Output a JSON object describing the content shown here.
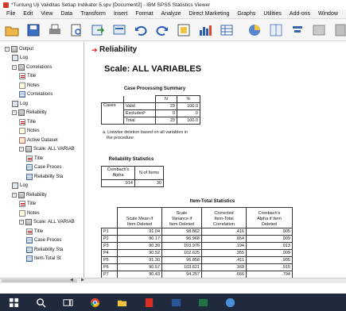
{
  "window": {
    "title": "*Tuntung Uji Validitas Setiap Indikator 5.spv [Document2] - IBM SPSS Statistics Viewer"
  },
  "menu": [
    {
      "label": "File"
    },
    {
      "label": "Edit"
    },
    {
      "label": "View"
    },
    {
      "label": "Data"
    },
    {
      "label": "Transform"
    },
    {
      "label": "Insert"
    },
    {
      "label": "Format"
    },
    {
      "label": "Analyze"
    },
    {
      "label": "Direct Marketing"
    },
    {
      "label": "Graphs"
    },
    {
      "label": "Utilities"
    },
    {
      "label": "Add-ons"
    },
    {
      "label": "Window"
    },
    {
      "label": "Help"
    }
  ],
  "toolbar_icons": [
    "open-icon",
    "save-icon",
    "print-icon",
    "print-preview-icon",
    "export-icon",
    "recall-dialog-icon",
    "undo-icon",
    "redo-icon",
    "goto-data-icon",
    "goto-case-icon",
    "variables-icon",
    "chart-icon",
    "pie-icon",
    "split-icon",
    "insert-output-icon",
    "designate-window-icon",
    "script-icon",
    "spss-icon"
  ],
  "nav": {
    "items": [
      {
        "label": "Output",
        "icon": "book-icon",
        "indent": 0,
        "box": "−"
      },
      {
        "label": "Log",
        "icon": "log-icon",
        "indent": 1,
        "box": ""
      },
      {
        "label": "Correlations",
        "icon": "book-icon",
        "indent": 1,
        "box": "−"
      },
      {
        "label": "Title",
        "icon": "title-icon",
        "indent": 2,
        "box": ""
      },
      {
        "label": "Notes",
        "icon": "notes-icon",
        "indent": 2,
        "box": ""
      },
      {
        "label": "Correlations",
        "icon": "table-icon",
        "indent": 2,
        "box": ""
      },
      {
        "label": "Log",
        "icon": "log-icon",
        "indent": 1,
        "box": ""
      },
      {
        "label": "Reliability",
        "icon": "book-icon",
        "indent": 1,
        "box": "−"
      },
      {
        "label": "Title",
        "icon": "title-icon",
        "indent": 2,
        "box": ""
      },
      {
        "label": "Notes",
        "icon": "notes-icon",
        "indent": 2,
        "box": ""
      },
      {
        "label": "Active Dataset",
        "icon": "data-icon",
        "indent": 2,
        "box": ""
      },
      {
        "label": "Scale: ALL VARIAB",
        "icon": "book-icon",
        "indent": 2,
        "box": "−"
      },
      {
        "label": "Title",
        "icon": "title-icon",
        "indent": 3,
        "box": ""
      },
      {
        "label": "Case Proces",
        "icon": "table-icon",
        "indent": 3,
        "box": ""
      },
      {
        "label": "Reliability Sta",
        "icon": "table-icon",
        "indent": 3,
        "box": ""
      },
      {
        "label": "Log",
        "icon": "log-icon",
        "indent": 1,
        "box": ""
      },
      {
        "label": "Reliability",
        "icon": "book-icon",
        "indent": 1,
        "box": "−"
      },
      {
        "label": "Title",
        "icon": "title-icon",
        "indent": 2,
        "box": ""
      },
      {
        "label": "Notes",
        "icon": "notes-icon",
        "indent": 2,
        "box": ""
      },
      {
        "label": "Scale: ALL VARIAB",
        "icon": "book-icon",
        "indent": 2,
        "box": "−"
      },
      {
        "label": "Title",
        "icon": "title-icon",
        "indent": 3,
        "box": ""
      },
      {
        "label": "Case Proces",
        "icon": "table-icon",
        "indent": 3,
        "box": ""
      },
      {
        "label": "Reliability Sta",
        "icon": "table-icon",
        "indent": 3,
        "box": ""
      },
      {
        "label": "Item-Total St",
        "icon": "table-icon",
        "indent": 3,
        "box": ""
      }
    ]
  },
  "content": {
    "heading": "Reliability",
    "scale_heading": "Scale: ALL VARIABLES",
    "case_summary": {
      "title": "Case Processing Summary",
      "col_n": "N",
      "col_pct": "%",
      "group": "Cases",
      "rows": [
        {
          "label": "Valid",
          "n": "23",
          "pct": "100.0"
        },
        {
          "label": "Excludedᵃ",
          "n": "0",
          "pct": ".0"
        },
        {
          "label": "Total",
          "n": "23",
          "pct": "100.0"
        }
      ],
      "footnote_line1": "a. Listwise deletion based on all variables in",
      "footnote_line2": "the procedure."
    },
    "reliability": {
      "title": "Reliability Statistics",
      "col1_line1": "Cronbach's",
      "col1_line2": "Alpha",
      "col2": "N of Items",
      "alpha": ".914",
      "n_items": "30"
    },
    "item_total": {
      "title": "Item-Total Statistics",
      "headers": [
        [
          "Scale Mean if",
          "Item Deleted"
        ],
        [
          "Scale",
          "Variance if",
          "Item Deleted"
        ],
        [
          "Corrected",
          "Item-Total",
          "Correlation"
        ],
        [
          "Cronbach's",
          "Alpha if Item",
          "Deleted"
        ]
      ],
      "rows": [
        {
          "item": "P1",
          "mean": "91.04",
          "var": "98.862",
          "corr": ".416",
          "alpha": ".905"
        },
        {
          "item": "P2",
          "mean": "90.17",
          "var": "96.968",
          "corr": ".654",
          "alpha": ".909"
        },
        {
          "item": "P3",
          "mean": "90.39",
          "var": "103.976",
          "corr": ".194",
          "alpha": ".913"
        },
        {
          "item": "P4",
          "mean": "90.52",
          "var": "102.625",
          "corr": ".355",
          "alpha": ".909"
        },
        {
          "item": "P5",
          "mean": "91.30",
          "var": "96.858",
          "corr": ".411",
          "alpha": ".905"
        },
        {
          "item": "P6",
          "mean": "90.57",
          "var": "103.621",
          "corr": ".169",
          "alpha": ".915"
        },
        {
          "item": "P7",
          "mean": "90.43",
          "var": "94.257",
          "corr": ".666",
          "alpha": ".794"
        }
      ]
    }
  },
  "taskbar_icons": [
    "windows-start-icon",
    "search-icon",
    "task-view-icon",
    "chrome-icon",
    "file-explorer-icon",
    "pdf-icon",
    "word-icon",
    "excel-icon",
    "spss-taskbar-icon"
  ],
  "colors": {
    "accent_red": "#d11111",
    "taskbar": "#1f2b3d",
    "nav_border": "#bfbfbf"
  }
}
